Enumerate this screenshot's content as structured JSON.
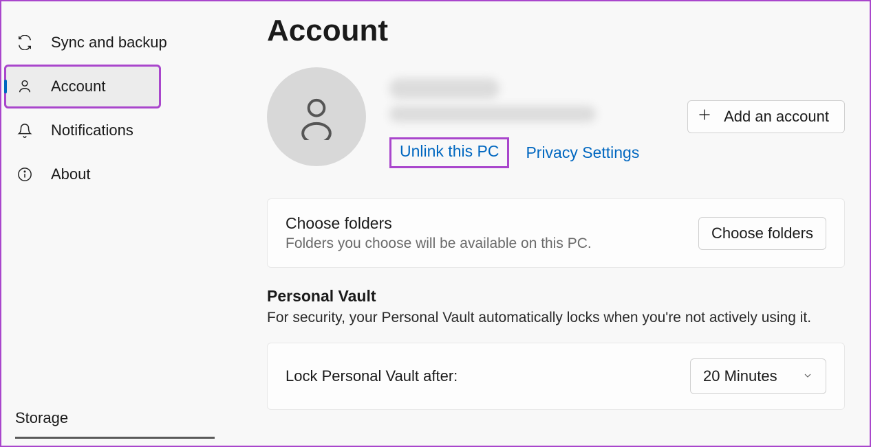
{
  "sidebar": {
    "items": [
      {
        "label": "Sync and backup"
      },
      {
        "label": "Account"
      },
      {
        "label": "Notifications"
      },
      {
        "label": "About"
      }
    ],
    "storage_label": "Storage"
  },
  "main": {
    "title": "Account",
    "add_account_label": "Add an account",
    "unlink_label": "Unlink this PC",
    "privacy_label": "Privacy Settings",
    "choose_folders": {
      "title": "Choose folders",
      "subtitle": "Folders you choose will be available on this PC.",
      "button": "Choose folders"
    },
    "vault": {
      "title": "Personal Vault",
      "description": "For security, your Personal Vault automatically locks when you're not actively using it.",
      "lock_label": "Lock Personal Vault after:",
      "lock_value": "20 Minutes"
    }
  }
}
